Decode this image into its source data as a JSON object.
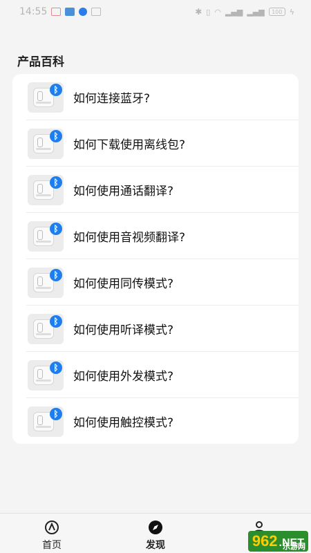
{
  "status_bar": {
    "time": "14:55",
    "battery": "100"
  },
  "section_title": "产品百科",
  "items": [
    {
      "label": "如何连接蓝牙?"
    },
    {
      "label": "如何下载使用离线包?"
    },
    {
      "label": "如何使用通话翻译?"
    },
    {
      "label": "如何使用音视频翻译?"
    },
    {
      "label": "如何使用同传模式?"
    },
    {
      "label": "如何使用听译模式?"
    },
    {
      "label": "如何使用外发模式?"
    },
    {
      "label": "如何使用触控模式?"
    }
  ],
  "nav": {
    "home_label": "首页",
    "discover_label": "发现",
    "mine_label": "我的"
  },
  "watermark": {
    "number": "962",
    "suffix": ".NET",
    "sub": "乐游网"
  },
  "colors": {
    "accent": "#1e7ef0",
    "background": "#f4f4f4"
  }
}
